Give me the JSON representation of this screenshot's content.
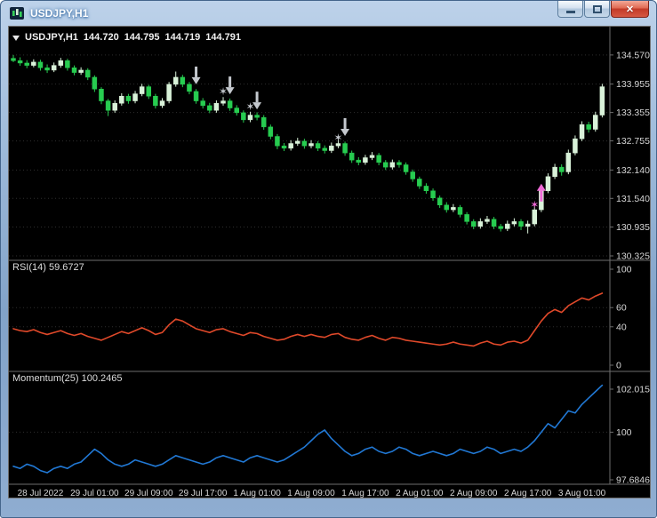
{
  "window": {
    "title": "USDJPY,H1",
    "controls": {
      "close_glyph": "✕"
    }
  },
  "chart": {
    "header": {
      "symbol": "USDJPY,H1",
      "open": "144.720",
      "high": "144.795",
      "low": "144.719",
      "close": "144.791"
    },
    "rsi_label": "RSI(14) 59.6727",
    "momentum_label": "Momentum(25) 100.2465"
  },
  "chart_data": {
    "type": "candlestick",
    "symbol": "USDJPY",
    "timeframe": "H1",
    "price_axis_labels": [
      "134.570",
      "133.955",
      "133.355",
      "132.755",
      "132.140",
      "131.540",
      "130.935",
      "130.325"
    ],
    "price_range": {
      "min": 130.25,
      "max": 135.15
    },
    "time_labels": [
      "28 Jul 2022",
      "29 Jul 01:00",
      "29 Jul 09:00",
      "29 Jul 17:00",
      "1 Aug 01:00",
      "1 Aug 09:00",
      "1 Aug 17:00",
      "2 Aug 01:00",
      "2 Aug 09:00",
      "2 Aug 17:00",
      "3 Aug 01:00"
    ],
    "time_tick_indices": [
      4,
      12,
      20,
      28,
      36,
      44,
      52,
      60,
      68,
      76,
      84
    ],
    "candles_ohlc": [
      [
        134.5,
        134.57,
        134.42,
        134.45
      ],
      [
        134.45,
        134.52,
        134.34,
        134.4
      ],
      [
        134.4,
        134.46,
        134.29,
        134.35
      ],
      [
        134.35,
        134.48,
        134.31,
        134.42
      ],
      [
        134.42,
        134.47,
        134.24,
        134.3
      ],
      [
        134.3,
        134.37,
        134.19,
        134.25
      ],
      [
        134.25,
        134.41,
        134.21,
        134.35
      ],
      [
        134.35,
        134.51,
        134.3,
        134.45
      ],
      [
        134.45,
        134.49,
        134.24,
        134.3
      ],
      [
        134.3,
        134.35,
        134.14,
        134.2
      ],
      [
        134.2,
        134.31,
        134.15,
        134.25
      ],
      [
        134.25,
        134.29,
        134.04,
        134.1
      ],
      [
        134.1,
        134.14,
        133.79,
        133.85
      ],
      [
        133.85,
        133.89,
        133.53,
        133.6
      ],
      [
        133.6,
        133.64,
        133.28,
        133.4
      ],
      [
        133.4,
        133.61,
        133.35,
        133.55
      ],
      [
        133.55,
        133.76,
        133.5,
        133.7
      ],
      [
        133.7,
        133.75,
        133.54,
        133.6
      ],
      [
        133.6,
        133.81,
        133.55,
        133.75
      ],
      [
        133.75,
        133.96,
        133.7,
        133.9
      ],
      [
        133.9,
        133.94,
        133.64,
        133.7
      ],
      [
        133.7,
        133.75,
        133.44,
        133.5
      ],
      [
        133.5,
        133.66,
        133.45,
        133.6
      ],
      [
        133.6,
        134.0,
        133.55,
        133.95
      ],
      [
        133.95,
        134.22,
        133.9,
        134.1
      ],
      [
        134.1,
        134.15,
        133.89,
        133.95
      ],
      [
        133.95,
        134.0,
        133.74,
        133.8
      ],
      [
        133.8,
        133.85,
        133.54,
        133.6
      ],
      [
        133.6,
        133.66,
        133.44,
        133.5
      ],
      [
        133.5,
        133.56,
        133.34,
        133.4
      ],
      [
        133.4,
        133.61,
        133.35,
        133.55
      ],
      [
        133.55,
        133.68,
        133.5,
        133.6
      ],
      [
        133.6,
        133.65,
        133.39,
        133.45
      ],
      [
        133.45,
        133.51,
        133.29,
        133.35
      ],
      [
        133.35,
        133.4,
        133.14,
        133.2
      ],
      [
        133.2,
        133.37,
        133.15,
        133.3
      ],
      [
        133.3,
        133.36,
        133.19,
        133.25
      ],
      [
        133.25,
        133.3,
        132.99,
        133.05
      ],
      [
        133.05,
        133.1,
        132.79,
        132.85
      ],
      [
        132.85,
        132.9,
        132.58,
        132.65
      ],
      [
        132.65,
        132.71,
        132.54,
        132.6
      ],
      [
        132.6,
        132.77,
        132.55,
        132.7
      ],
      [
        132.7,
        132.82,
        132.65,
        132.75
      ],
      [
        132.75,
        132.8,
        132.59,
        132.65
      ],
      [
        132.65,
        132.77,
        132.6,
        132.7
      ],
      [
        132.7,
        132.75,
        132.54,
        132.6
      ],
      [
        132.6,
        132.66,
        132.49,
        132.55
      ],
      [
        132.55,
        132.72,
        132.5,
        132.65
      ],
      [
        132.65,
        132.78,
        132.6,
        132.7
      ],
      [
        132.7,
        132.74,
        132.44,
        132.5
      ],
      [
        132.5,
        132.55,
        132.29,
        132.35
      ],
      [
        132.35,
        132.41,
        132.24,
        132.3
      ],
      [
        132.3,
        132.46,
        132.25,
        132.4
      ],
      [
        132.4,
        132.52,
        132.35,
        132.45
      ],
      [
        132.45,
        132.5,
        132.24,
        132.3
      ],
      [
        132.3,
        132.35,
        132.14,
        132.2
      ],
      [
        132.2,
        132.36,
        132.15,
        132.3
      ],
      [
        132.3,
        132.35,
        132.19,
        132.25
      ],
      [
        132.25,
        132.3,
        132.04,
        132.1
      ],
      [
        132.1,
        132.15,
        131.89,
        131.95
      ],
      [
        131.95,
        132.0,
        131.74,
        131.8
      ],
      [
        131.8,
        131.86,
        131.64,
        131.7
      ],
      [
        131.7,
        131.75,
        131.49,
        131.55
      ],
      [
        131.55,
        131.6,
        131.34,
        131.4
      ],
      [
        131.4,
        131.46,
        131.24,
        131.3
      ],
      [
        131.3,
        131.42,
        131.25,
        131.35
      ],
      [
        131.35,
        131.4,
        131.14,
        131.2
      ],
      [
        131.2,
        131.25,
        130.99,
        131.05
      ],
      [
        131.05,
        131.1,
        130.89,
        130.95
      ],
      [
        130.95,
        131.12,
        130.9,
        131.05
      ],
      [
        131.05,
        131.17,
        131.0,
        131.1
      ],
      [
        131.1,
        131.15,
        130.89,
        130.95
      ],
      [
        130.95,
        131.0,
        130.84,
        130.9
      ],
      [
        130.9,
        131.07,
        130.85,
        131.0
      ],
      [
        131.0,
        131.12,
        130.95,
        131.05
      ],
      [
        131.05,
        131.1,
        130.87,
        130.95
      ],
      [
        130.95,
        131.07,
        130.8,
        131.0
      ],
      [
        131.0,
        131.37,
        130.95,
        131.3
      ],
      [
        131.3,
        131.77,
        131.25,
        131.7
      ],
      [
        131.7,
        132.07,
        131.65,
        132.0
      ],
      [
        132.0,
        132.27,
        131.95,
        132.2
      ],
      [
        132.2,
        132.26,
        132.02,
        132.1
      ],
      [
        132.1,
        132.57,
        132.05,
        132.5
      ],
      [
        132.5,
        132.87,
        132.45,
        132.8
      ],
      [
        132.8,
        133.17,
        132.75,
        133.1
      ],
      [
        133.1,
        133.16,
        132.93,
        133.0
      ],
      [
        133.0,
        133.37,
        132.95,
        133.3
      ],
      [
        133.3,
        133.96,
        133.25,
        133.9
      ]
    ],
    "annotations": [
      {
        "type": "arrow-down",
        "index": 27,
        "price": 133.95,
        "color": "#c4c8ce"
      },
      {
        "type": "star",
        "index": 31,
        "price": 133.8,
        "color": "#c4c8ce"
      },
      {
        "type": "arrow-down",
        "index": 32,
        "price": 133.74,
        "color": "#c4c8ce"
      },
      {
        "type": "star",
        "index": 35,
        "price": 133.48,
        "color": "#c4c8ce"
      },
      {
        "type": "arrow-down",
        "index": 36,
        "price": 133.42,
        "color": "#c4c8ce"
      },
      {
        "type": "star",
        "index": 48,
        "price": 132.82,
        "color": "#c4c8ce"
      },
      {
        "type": "arrow-down",
        "index": 49,
        "price": 132.86,
        "color": "#c4c8ce"
      },
      {
        "type": "star",
        "index": 77,
        "price": 131.4,
        "color": "#ef6ad6"
      },
      {
        "type": "arrow-up",
        "index": 78,
        "price": 131.85,
        "color": "#ef6ad6"
      }
    ],
    "indicators": [
      {
        "name": "RSI",
        "params": "14",
        "current": "59.6727",
        "color": "#e0492a",
        "axis_labels": [
          "100",
          "60",
          "40",
          "0"
        ],
        "axis_values": [
          100,
          60,
          40,
          0
        ],
        "levels": [
          60,
          40
        ],
        "range": {
          "min": 0,
          "max": 100
        },
        "values": [
          38,
          36,
          35,
          37,
          34,
          32,
          34,
          36,
          33,
          31,
          33,
          30,
          28,
          26,
          29,
          32,
          35,
          33,
          36,
          39,
          36,
          32,
          34,
          42,
          48,
          46,
          42,
          38,
          36,
          34,
          37,
          38,
          35,
          33,
          31,
          34,
          33,
          30,
          28,
          26,
          27,
          30,
          32,
          30,
          32,
          30,
          29,
          32,
          33,
          29,
          27,
          26,
          29,
          31,
          28,
          26,
          29,
          28,
          26,
          25,
          24,
          23,
          22,
          21,
          22,
          24,
          22,
          21,
          20,
          23,
          25,
          22,
          21,
          24,
          25,
          23,
          26,
          36,
          46,
          54,
          58,
          55,
          62,
          66,
          70,
          68,
          72,
          75
        ]
      },
      {
        "name": "Momentum",
        "params": "25",
        "current": "100.2465",
        "color": "#2178d4",
        "axis_labels": [
          "102.015",
          "100",
          "97.6846"
        ],
        "axis_values": [
          102.015,
          100,
          97.6846
        ],
        "levels": [
          100
        ],
        "values": [
          98.4,
          98.3,
          98.5,
          98.4,
          98.2,
          98.1,
          98.3,
          98.4,
          98.3,
          98.5,
          98.6,
          98.9,
          99.2,
          99.0,
          98.7,
          98.5,
          98.4,
          98.5,
          98.7,
          98.6,
          98.5,
          98.4,
          98.5,
          98.7,
          98.9,
          98.8,
          98.7,
          98.6,
          98.5,
          98.6,
          98.8,
          98.9,
          98.8,
          98.7,
          98.6,
          98.8,
          98.9,
          98.8,
          98.7,
          98.6,
          98.7,
          98.9,
          99.1,
          99.3,
          99.6,
          99.9,
          100.1,
          99.7,
          99.4,
          99.1,
          98.9,
          99.0,
          99.2,
          99.3,
          99.1,
          99.0,
          99.1,
          99.3,
          99.2,
          99.0,
          98.9,
          99.0,
          99.1,
          99.0,
          98.9,
          99.0,
          99.2,
          99.1,
          99.0,
          99.1,
          99.3,
          99.2,
          99.0,
          99.1,
          99.2,
          99.1,
          99.3,
          99.6,
          100.0,
          100.4,
          100.2,
          100.6,
          101.0,
          100.9,
          101.3,
          101.6,
          101.9,
          102.2
        ]
      }
    ],
    "colors": {
      "background": "#000000",
      "bull": "#d9f2d9",
      "bear": "#27cc50",
      "grid": "#2e2e2e",
      "axis_text": "#d6d6d6",
      "separator": "#6e6e6e",
      "annotation_gray": "#c4c8ce",
      "annotation_pink": "#ef6ad6",
      "rsi_line": "#e0492a",
      "momentum_line": "#2178d4"
    }
  }
}
